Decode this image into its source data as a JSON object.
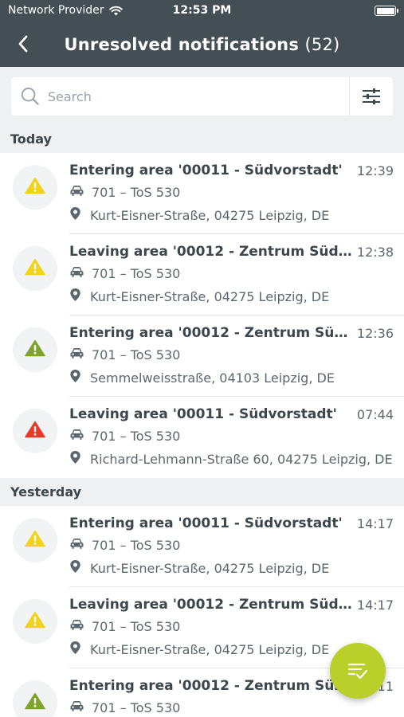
{
  "status_bar": {
    "carrier": "Network Provider",
    "time": "12:53 PM"
  },
  "nav": {
    "title": "Unresolved notifications",
    "count": "(52)"
  },
  "search": {
    "placeholder": "Search"
  },
  "colors": {
    "warning_yellow": "#f2d21b",
    "info_green": "#7fa32b",
    "alert_red": "#e8382a",
    "fab": "#b9cf2a",
    "header_bg": "#434e55"
  },
  "sections": [
    {
      "label": "Today",
      "items": [
        {
          "title": "Entering area '00011 - Südvorstadt'",
          "time": "12:39",
          "vehicle": "701 – ToS 530",
          "location": "Kurt-Eisner-Straße, 04275 Leipzig, DE",
          "severity": "warning"
        },
        {
          "title": "Leaving area '00012 - Zentrum Süd...",
          "time": "12:38",
          "vehicle": "701 – ToS 530",
          "location": "Kurt-Eisner-Straße, 04275 Leipzig, DE",
          "severity": "warning"
        },
        {
          "title": "Entering area '00012 - Zentrum Süd...",
          "time": "12:36",
          "vehicle": "701 – ToS 530",
          "location": "Semmelweisstraße, 04103 Leipzig, DE",
          "severity": "info"
        },
        {
          "title": "Leaving area '00011 - Südvorstadt'",
          "time": "07:44",
          "vehicle": "701 – ToS 530",
          "location": "Richard-Lehmann-Straße 60, 04275 Leipzig, DE",
          "severity": "alert"
        }
      ]
    },
    {
      "label": "Yesterday",
      "items": [
        {
          "title": "Entering area '00011 - Südvorstadt'",
          "time": "14:17",
          "vehicle": "701 – ToS 530",
          "location": "Kurt-Eisner-Straße, 04275 Leipzig, DE",
          "severity": "warning"
        },
        {
          "title": "Leaving area '00012 - Zentrum Südo...",
          "time": "14:17",
          "vehicle": "701 – ToS 530",
          "location": "Kurt-Eisner-Straße, 04275 Leipzig, DE",
          "severity": "warning"
        },
        {
          "title": "Entering area '00012 - Zentrum Süd...",
          "time": "14:11",
          "vehicle": "701 – ToS 530",
          "location": "",
          "severity": "info"
        }
      ]
    }
  ]
}
